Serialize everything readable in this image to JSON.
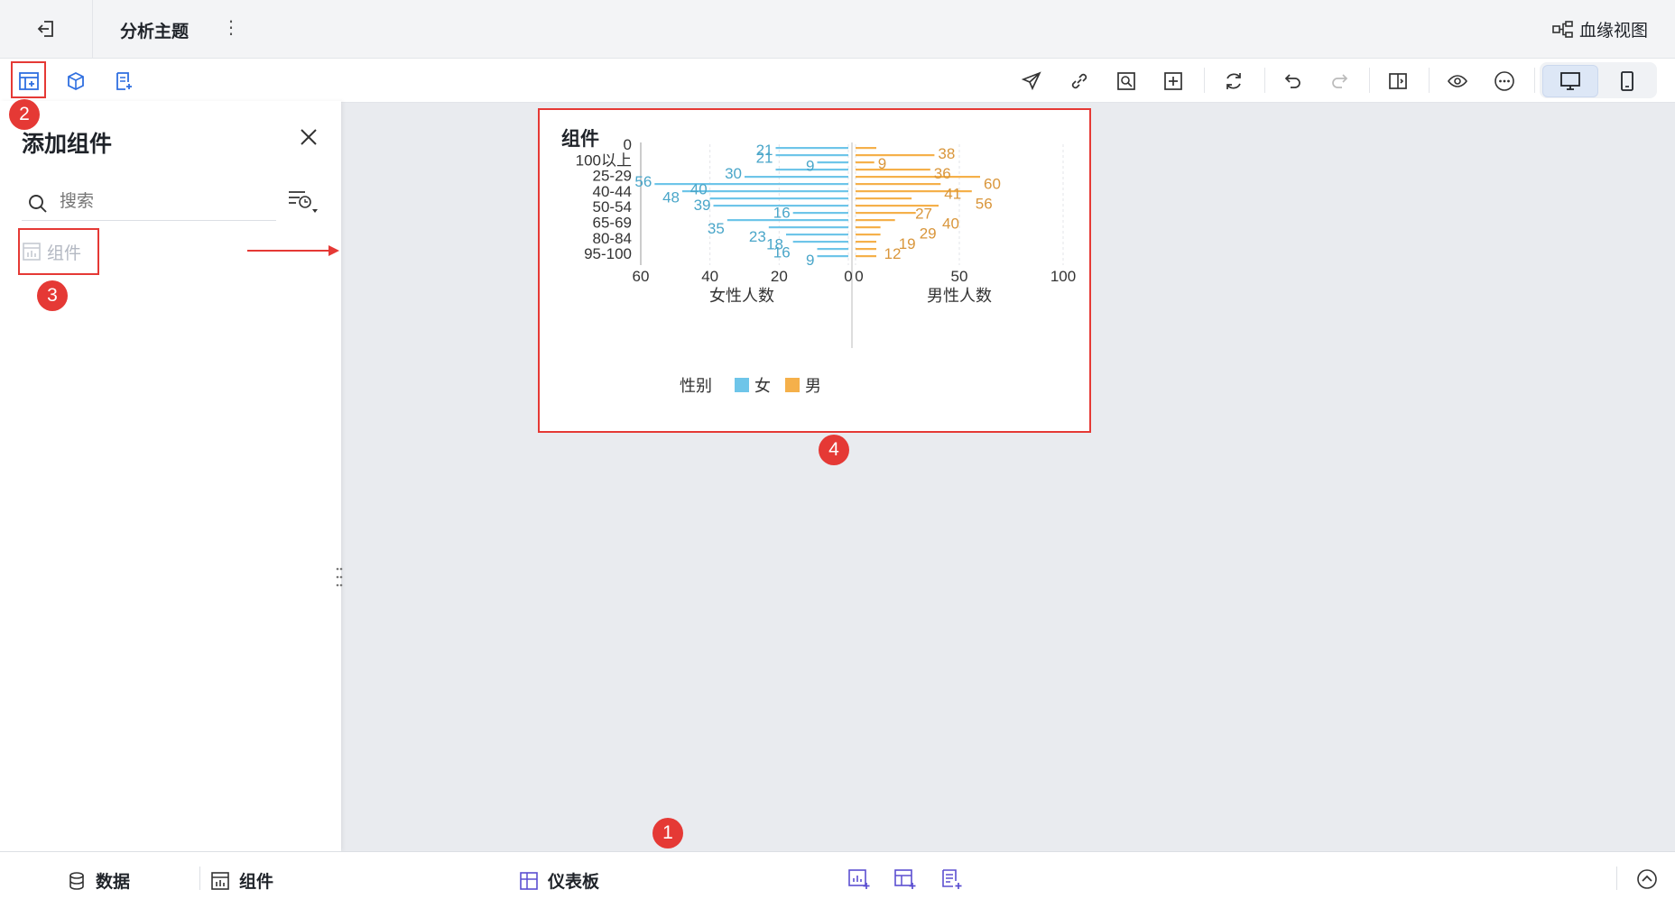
{
  "header": {
    "title": "分析主题",
    "more_glyph": "⋮",
    "lineage_label": "血缘视图"
  },
  "toolbar": {
    "left_icons": [
      "add-component-icon",
      "add-model-icon",
      "add-report-icon"
    ],
    "right_icons": [
      "send-icon",
      "link-icon",
      "image-search-icon",
      "grid-icon",
      "refresh-icon",
      "undo-icon",
      "redo-icon",
      "switch-view-icon",
      "eye-icon",
      "more-icon",
      "desktop-icon",
      "mobile-icon"
    ]
  },
  "panel": {
    "title": "添加组件",
    "search_placeholder": "搜索",
    "item_label": "组件"
  },
  "card": {
    "title": "组件"
  },
  "chart_data": {
    "type": "bar",
    "subtype": "population-pyramid",
    "categories": [
      "0",
      "100以上",
      "25-29",
      "40-44",
      "50-54",
      "65-69",
      "80-84",
      "95-100"
    ],
    "left_axis": {
      "label": "女性人数",
      "ticks": [
        "60",
        "40",
        "20",
        "0"
      ],
      "range": [
        0,
        60
      ]
    },
    "right_axis": {
      "label": "男性人数",
      "ticks": [
        "0",
        "50",
        "100"
      ],
      "range": [
        0,
        100
      ]
    },
    "female_values": [
      21,
      21,
      9,
      21,
      30,
      56,
      48,
      40,
      39,
      16,
      35,
      23,
      18,
      16,
      9,
      9
    ],
    "male_values": [
      10,
      38,
      9,
      36,
      60,
      41,
      56,
      27,
      40,
      29,
      19,
      12,
      12,
      10,
      10,
      10
    ],
    "female_labels": [
      "21",
      "9",
      "21",
      "30",
      "56",
      "48",
      "40",
      "16",
      "39",
      "23",
      "35",
      "18",
      "16",
      "9"
    ],
    "male_labels": [
      "38",
      "9",
      "36",
      "60",
      "41",
      "56",
      "27",
      "40",
      "29",
      "19",
      "12"
    ],
    "legend": {
      "title": "性别",
      "items": [
        {
          "name": "女",
          "color": "#6ec5e9"
        },
        {
          "name": "男",
          "color": "#f5b04a"
        }
      ]
    }
  },
  "badges": [
    "1",
    "2",
    "3",
    "4"
  ],
  "bottombar": {
    "data_label": "数据",
    "component_label": "组件",
    "dashboard_label": "仪表板"
  },
  "colors": {
    "accent": "#2f6fe0",
    "highlight": "#e53935",
    "female": "#6ec5e9",
    "male": "#f5b04a"
  }
}
